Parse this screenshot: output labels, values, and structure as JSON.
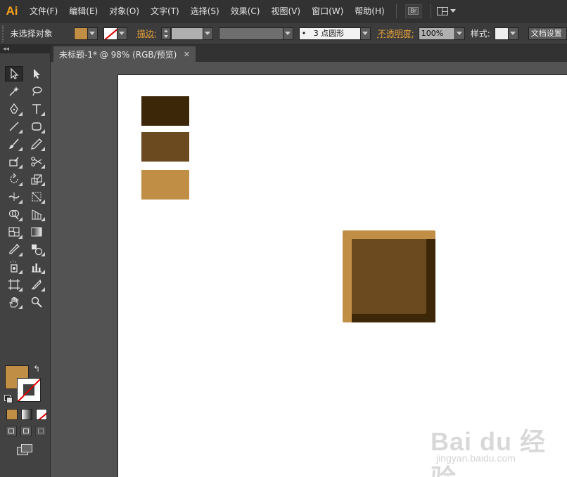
{
  "app": {
    "logo": "Ai"
  },
  "menu": [
    "文件(F)",
    "编辑(E)",
    "对象(O)",
    "文字(T)",
    "选择(S)",
    "效果(C)",
    "视图(V)",
    "窗口(W)",
    "帮助(H)"
  ],
  "menubar_buttons": {
    "bridge": "Br"
  },
  "control_bar": {
    "selection_status": "未选择对象",
    "stroke_label": "描边:",
    "brush_value": "3 点圆形",
    "brush_bullet": "•",
    "opacity_label": "不透明度:",
    "opacity_value": "100%",
    "style_label": "样式:",
    "doc_setup": "文档设置"
  },
  "tool_panel": {
    "collapse_glyph": "◂◂"
  },
  "document_tab": {
    "title": "未标题-1* @ 98% (RGB/预览)",
    "close": "✕"
  },
  "colors": {
    "fill": "#c08e45",
    "swatch_dark": "#3d2709",
    "swatch_mid": "#6b4a1f",
    "swatch_light": "#c08e45",
    "frame_light": "#c08e45",
    "frame_dark": "#3d2709",
    "frame_mid": "#6b4a1f"
  },
  "watermark": {
    "brand": "Bai du 经验",
    "site": "jingyan.baidu.com"
  }
}
